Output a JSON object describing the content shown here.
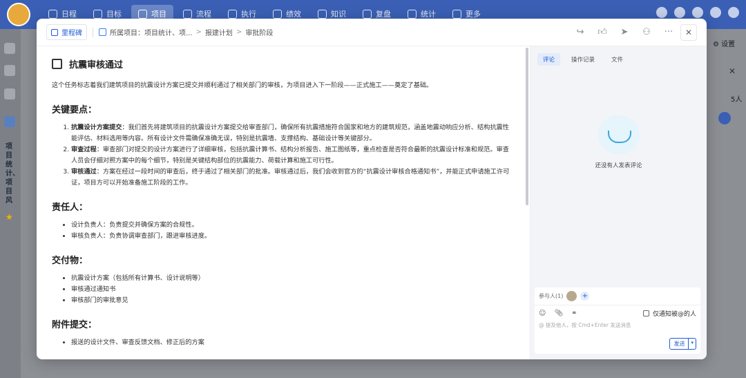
{
  "nav": {
    "items": [
      "日程",
      "目标",
      "项目",
      "流程",
      "执行",
      "绩效",
      "知识",
      "复盘",
      "统计",
      "更多"
    ],
    "active": "项目"
  },
  "background": {
    "settings": "设置",
    "members": "5人",
    "left_vertical": "项目统计、项目风"
  },
  "header": {
    "type_badge": "里程碑",
    "breadcrumb": [
      "所属项目：项目统计、项...",
      "报建计划",
      "审批阶段"
    ]
  },
  "task": {
    "title": "抗震审核通过",
    "intro": "这个任务标志着我们建筑项目的抗震设计方案已提交并顺利通过了相关部门的审核，为项目进入下一阶段——正式施工——奠定了基础。",
    "sections": [
      {
        "heading": "关键要点：",
        "ordered": true,
        "items": [
          {
            "bold": "抗震设计方案提交",
            "text": "：我们首先将建筑项目的抗震设计方案提交给审查部门，确保所有抗震措施符合国家和地方的建筑规范，涵盖地震动响应分析、结构抗震性能评估、材料选用等内容。所有设计文件需确保准确无误，特别是抗震墙、支撑结构、基础设计等关键部分。"
          },
          {
            "bold": "审查过程",
            "text": "：审查部门对提交的设计方案进行了详细审核，包括抗震计算书、结构分析报告、施工图纸等，重点检查是否符合最新的抗震设计标准和规范。审查人员会仔细对照方案中的每个细节，特别是关键结构部位的抗震能力、荷载计算和施工可行性。"
          },
          {
            "bold": "审核通过",
            "text": "：方案在经过一段时间的审查后，终于通过了相关部门的批准。审核通过后，我们会收到官方的“抗震设计审核合格通知书”，并能正式申请施工许可证，项目方可以开始准备施工阶段的工作。"
          }
        ]
      },
      {
        "heading": "责任人：",
        "ordered": false,
        "items": [
          {
            "bold": "",
            "text": "设计负责人：负责提交并确保方案的合规性。"
          },
          {
            "bold": "",
            "text": "审核负责人：负责协调审查部门，跟进审核进度。"
          }
        ]
      },
      {
        "heading": "交付物：",
        "ordered": false,
        "items": [
          {
            "bold": "",
            "text": "抗震设计方案（包括所有计算书、设计说明等）"
          },
          {
            "bold": "",
            "text": "审核通过通知书"
          },
          {
            "bold": "",
            "text": "审核部门的审批意见"
          }
        ]
      },
      {
        "heading": "附件提交：",
        "ordered": false,
        "items": [
          {
            "bold": "",
            "text": "报送的设计文件、审查反馈文档、修正后的方案"
          }
        ]
      }
    ]
  },
  "panel": {
    "tabs": [
      "评论",
      "操作记录",
      "文件"
    ],
    "active_tab": "评论",
    "empty_text": "还没有人发表评论",
    "participants_label": "参与人(1)",
    "notify_label": "仅通知被@的人",
    "placeholder": "@ 提及他人，按 Cmd+Enter 发送消息",
    "send_label": "发送"
  },
  "icons": [
    "share-icon",
    "like-icon",
    "send-icon",
    "user-icon",
    "more-icon",
    "close-icon"
  ],
  "colors": {
    "accent": "#1d5bd8",
    "topbar": "#3a5fb4"
  }
}
